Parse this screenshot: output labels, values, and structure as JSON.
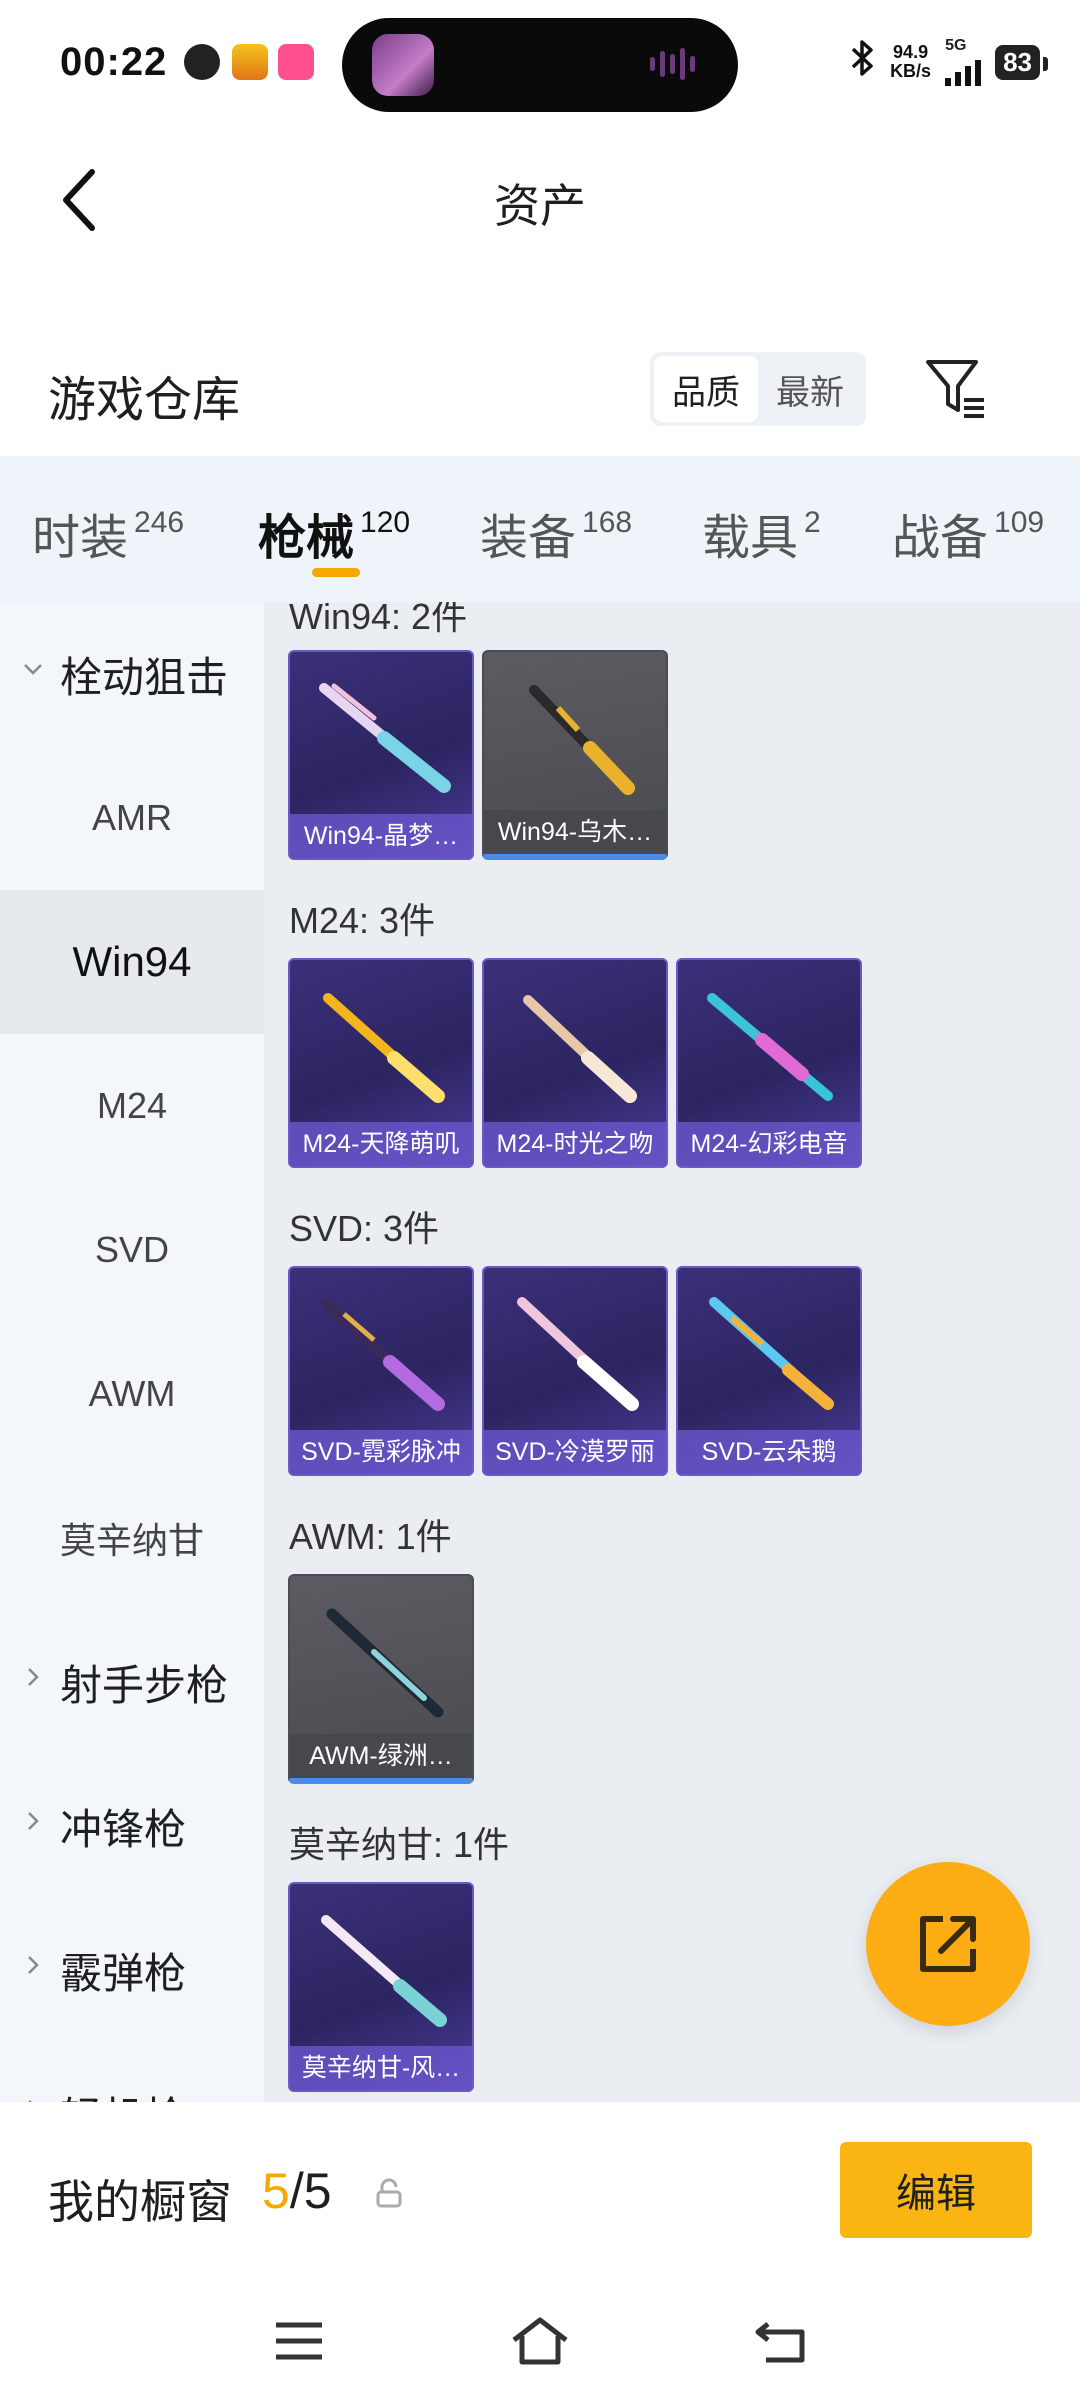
{
  "status_bar": {
    "time": "00:22",
    "net_speed_value": "94.9",
    "net_speed_unit": "KB/s",
    "network": "5G",
    "battery": "83"
  },
  "header": {
    "title": "资产"
  },
  "warehouse": {
    "title": "游戏仓库",
    "sort_options": [
      "品质",
      "最新"
    ],
    "active_sort": "品质"
  },
  "tabs": [
    {
      "label": "时装",
      "count": "246"
    },
    {
      "label": "枪械",
      "count": "120"
    },
    {
      "label": "装备",
      "count": "168"
    },
    {
      "label": "载具",
      "count": "2"
    },
    {
      "label": "战备",
      "count": "109"
    }
  ],
  "active_tab": "枪械",
  "sidebar": [
    {
      "label": "栓动狙击",
      "type": "group",
      "expanded": true
    },
    {
      "label": "AMR",
      "type": "sub"
    },
    {
      "label": "Win94",
      "type": "sub",
      "selected": true
    },
    {
      "label": "M24",
      "type": "sub"
    },
    {
      "label": "SVD",
      "type": "sub"
    },
    {
      "label": "AWM",
      "type": "sub"
    },
    {
      "label": "莫辛纳甘",
      "type": "sub"
    },
    {
      "label": "射手步枪",
      "type": "group",
      "expanded": false
    },
    {
      "label": "冲锋枪",
      "type": "group",
      "expanded": false
    },
    {
      "label": "霰弹枪",
      "type": "group",
      "expanded": false
    },
    {
      "label": "轻机枪",
      "type": "group",
      "expanded": false
    }
  ],
  "sections": [
    {
      "title": "Win94: 2件",
      "items": [
        {
          "label": "Win94-晶梦…",
          "rarity": "purple",
          "colors": [
            "#e7d6f2",
            "#7ad3e6"
          ]
        },
        {
          "label": "Win94-乌木…",
          "rarity": "grey",
          "colors": [
            "#2a2a2a",
            "#e8b22c"
          ]
        }
      ]
    },
    {
      "title": "M24: 3件",
      "items": [
        {
          "label": "M24-天降萌叽",
          "rarity": "purple",
          "colors": [
            "#f2b51c",
            "#ffdf6b"
          ]
        },
        {
          "label": "M24-时光之吻",
          "rarity": "purple",
          "colors": [
            "#e6c7a8",
            "#f6e7d7"
          ]
        },
        {
          "label": "M24-幻彩电音",
          "rarity": "purple",
          "colors": [
            "#3ac4d8",
            "#e06ad6"
          ]
        }
      ]
    },
    {
      "title": "SVD: 3件",
      "items": [
        {
          "label": "SVD-霓彩脉冲",
          "rarity": "purple",
          "colors": [
            "#3a2a5a",
            "#e2b04a"
          ]
        },
        {
          "label": "SVD-冷漠罗丽",
          "rarity": "purple",
          "colors": [
            "#f0c6dc",
            "#ffffff"
          ]
        },
        {
          "label": "SVD-云朵鹅",
          "rarity": "purple",
          "colors": [
            "#5cc8ef",
            "#f5b23a"
          ]
        }
      ]
    },
    {
      "title": "AWM: 1件",
      "items": [
        {
          "label": "AWM-绿洲…",
          "rarity": "grey",
          "colors": [
            "#1d2a36",
            "#8fd3d8"
          ]
        }
      ]
    },
    {
      "title": "莫辛纳甘: 1件",
      "items": [
        {
          "label": "莫辛纳甘-风…",
          "rarity": "purple",
          "colors": [
            "#f4e8f5",
            "#7bd2d6"
          ]
        }
      ]
    }
  ],
  "showcase": {
    "title": "我的橱窗",
    "current": "5",
    "total": "5",
    "edit_label": "编辑"
  },
  "colors": {
    "accent": "#f5a800",
    "button": "#fbb513",
    "tab_bg": "#eef4f9",
    "grid_bg": "#eaeef3",
    "purple_card": "#3c2f7a",
    "grey_card": "#55555b",
    "selected_bar": "#4d8be8"
  }
}
